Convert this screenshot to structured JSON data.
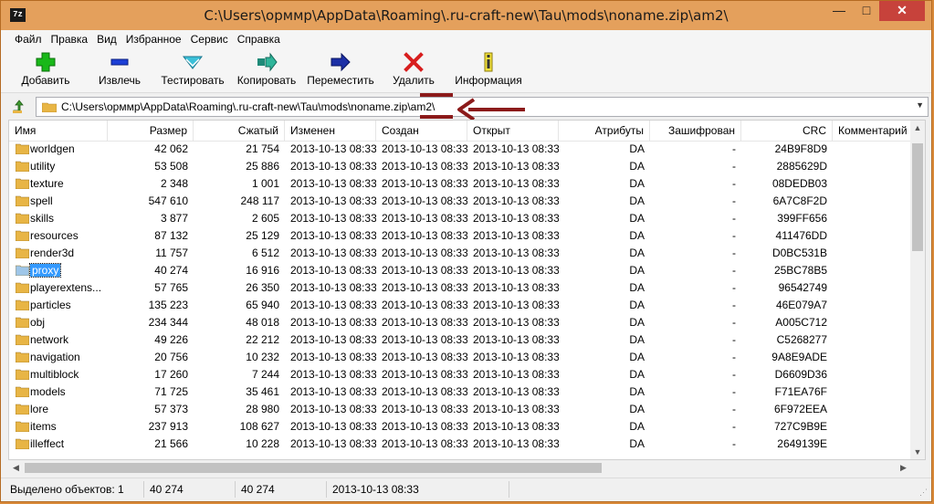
{
  "window": {
    "title": "C:\\Users\\орммр\\AppData\\Roaming\\.ru-craft-new\\Tau\\mods\\noname.zip\\am2\\",
    "app_icon_text": "7z",
    "minimize": "—",
    "maximize": "□",
    "close": "✕"
  },
  "menu": [
    "Файл",
    "Правка",
    "Вид",
    "Избранное",
    "Сервис",
    "Справка"
  ],
  "toolbar": [
    {
      "label": "Добавить",
      "icon": "add-icon"
    },
    {
      "label": "Извлечь",
      "icon": "extract-icon"
    },
    {
      "label": "Тестировать",
      "icon": "test-icon"
    },
    {
      "label": "Копировать",
      "icon": "copy-icon"
    },
    {
      "label": "Переместить",
      "icon": "move-icon"
    },
    {
      "label": "Удалить",
      "icon": "delete-icon"
    },
    {
      "label": "Информация",
      "icon": "info-icon"
    }
  ],
  "address": {
    "path": "C:\\Users\\орммр\\AppData\\Roaming\\.ru-craft-new\\Tau\\mods\\noname.zip\\am2\\"
  },
  "columns": [
    "Имя",
    "Размер",
    "Сжатый",
    "Изменен",
    "Создан",
    "Открыт",
    "Атрибуты",
    "Зашифрован",
    "CRC",
    "Комментарий"
  ],
  "rows": [
    {
      "name": "worldgen",
      "size": "42 062",
      "packed": "21 754",
      "modified": "2013-10-13 08:33",
      "created": "2013-10-13 08:33",
      "accessed": "2013-10-13 08:33",
      "attr": "DA",
      "enc": "-",
      "crc": "24B9F8D9"
    },
    {
      "name": "utility",
      "size": "53 508",
      "packed": "25 886",
      "modified": "2013-10-13 08:33",
      "created": "2013-10-13 08:33",
      "accessed": "2013-10-13 08:33",
      "attr": "DA",
      "enc": "-",
      "crc": "2885629D"
    },
    {
      "name": "texture",
      "size": "2 348",
      "packed": "1 001",
      "modified": "2013-10-13 08:33",
      "created": "2013-10-13 08:33",
      "accessed": "2013-10-13 08:33",
      "attr": "DA",
      "enc": "-",
      "crc": "08DEDB03"
    },
    {
      "name": "spell",
      "size": "547 610",
      "packed": "248 117",
      "modified": "2013-10-13 08:33",
      "created": "2013-10-13 08:33",
      "accessed": "2013-10-13 08:33",
      "attr": "DA",
      "enc": "-",
      "crc": "6A7C8F2D"
    },
    {
      "name": "skills",
      "size": "3 877",
      "packed": "2 605",
      "modified": "2013-10-13 08:33",
      "created": "2013-10-13 08:33",
      "accessed": "2013-10-13 08:33",
      "attr": "DA",
      "enc": "-",
      "crc": "399FF656"
    },
    {
      "name": "resources",
      "size": "87 132",
      "packed": "25 129",
      "modified": "2013-10-13 08:33",
      "created": "2013-10-13 08:33",
      "accessed": "2013-10-13 08:33",
      "attr": "DA",
      "enc": "-",
      "crc": "411476DD"
    },
    {
      "name": "render3d",
      "size": "11 757",
      "packed": "6 512",
      "modified": "2013-10-13 08:33",
      "created": "2013-10-13 08:33",
      "accessed": "2013-10-13 08:33",
      "attr": "DA",
      "enc": "-",
      "crc": "D0BC531B"
    },
    {
      "name": "proxy",
      "size": "40 274",
      "packed": "16 916",
      "modified": "2013-10-13 08:33",
      "created": "2013-10-13 08:33",
      "accessed": "2013-10-13 08:33",
      "attr": "DA",
      "enc": "-",
      "crc": "25BC78B5",
      "selected": true
    },
    {
      "name": "playerextens...",
      "size": "57 765",
      "packed": "26 350",
      "modified": "2013-10-13 08:33",
      "created": "2013-10-13 08:33",
      "accessed": "2013-10-13 08:33",
      "attr": "DA",
      "enc": "-",
      "crc": "96542749"
    },
    {
      "name": "particles",
      "size": "135 223",
      "packed": "65 940",
      "modified": "2013-10-13 08:33",
      "created": "2013-10-13 08:33",
      "accessed": "2013-10-13 08:33",
      "attr": "DA",
      "enc": "-",
      "crc": "46E079A7"
    },
    {
      "name": "obj",
      "size": "234 344",
      "packed": "48 018",
      "modified": "2013-10-13 08:33",
      "created": "2013-10-13 08:33",
      "accessed": "2013-10-13 08:33",
      "attr": "DA",
      "enc": "-",
      "crc": "A005C712"
    },
    {
      "name": "network",
      "size": "49 226",
      "packed": "22 212",
      "modified": "2013-10-13 08:33",
      "created": "2013-10-13 08:33",
      "accessed": "2013-10-13 08:33",
      "attr": "DA",
      "enc": "-",
      "crc": "C5268277"
    },
    {
      "name": "navigation",
      "size": "20 756",
      "packed": "10 232",
      "modified": "2013-10-13 08:33",
      "created": "2013-10-13 08:33",
      "accessed": "2013-10-13 08:33",
      "attr": "DA",
      "enc": "-",
      "crc": "9A8E9ADE"
    },
    {
      "name": "multiblock",
      "size": "17 260",
      "packed": "7 244",
      "modified": "2013-10-13 08:33",
      "created": "2013-10-13 08:33",
      "accessed": "2013-10-13 08:33",
      "attr": "DA",
      "enc": "-",
      "crc": "D6609D36"
    },
    {
      "name": "models",
      "size": "71 725",
      "packed": "35 461",
      "modified": "2013-10-13 08:33",
      "created": "2013-10-13 08:33",
      "accessed": "2013-10-13 08:33",
      "attr": "DA",
      "enc": "-",
      "crc": "F71EA76F"
    },
    {
      "name": "lore",
      "size": "57 373",
      "packed": "28 980",
      "modified": "2013-10-13 08:33",
      "created": "2013-10-13 08:33",
      "accessed": "2013-10-13 08:33",
      "attr": "DA",
      "enc": "-",
      "crc": "6F972EEA"
    },
    {
      "name": "items",
      "size": "237 913",
      "packed": "108 627",
      "modified": "2013-10-13 08:33",
      "created": "2013-10-13 08:33",
      "accessed": "2013-10-13 08:33",
      "attr": "DA",
      "enc": "-",
      "crc": "727C9B9E"
    },
    {
      "name": "illeffect",
      "size": "21 566",
      "packed": "10 228",
      "modified": "2013-10-13 08:33",
      "created": "2013-10-13 08:33",
      "accessed": "2013-10-13 08:33",
      "attr": "DA",
      "enc": "-",
      "crc": "2649139E"
    }
  ],
  "status": {
    "selected": "Выделено объектов: 1",
    "size": "40 274",
    "packed": "40 274",
    "date": "2013-10-13 08:33"
  },
  "colors": {
    "titlebar": "#e4a05c",
    "close": "#c7423b",
    "selection": "#3399ff",
    "annotation": "#8b1a1a",
    "folder": "#e8b545"
  }
}
